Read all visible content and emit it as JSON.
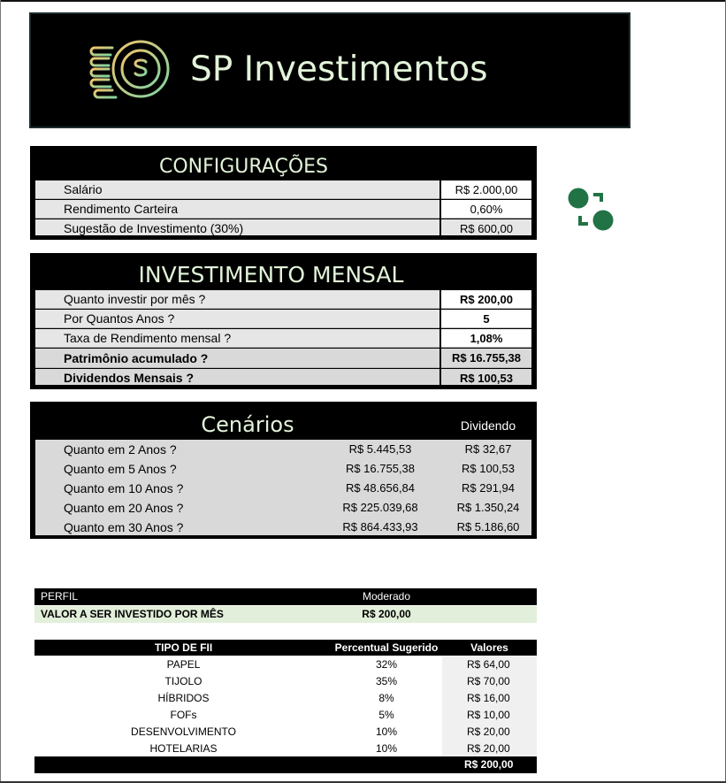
{
  "header": {
    "title": "SP Investimentos",
    "logo_icon": "coin-dollar-icon",
    "title_color": "#e2f3d9"
  },
  "configuracoes": {
    "title": "CONFIGURAÇÕES",
    "rows": [
      {
        "label": "Salário",
        "value": "R$ 2.000,00"
      },
      {
        "label": "Rendimento Carteira",
        "value": "0,60%"
      },
      {
        "label": "Sugestão de Investimento (30%)",
        "value": "R$ 600,00"
      }
    ]
  },
  "investimento": {
    "title": "INVESTIMENTO MENSAL",
    "rows": [
      {
        "label": "Quanto investir por mês ?",
        "value": "R$ 200,00"
      },
      {
        "label": "Por Quantos Anos ?",
        "value": "5"
      },
      {
        "label": "Taxa de Rendimento mensal ?",
        "value": "1,08%"
      },
      {
        "label": "Patrimônio acumulado ?",
        "value": "R$ 16.755,38"
      },
      {
        "label": "Dividendos Mensais ?",
        "value": "R$ 100,53"
      }
    ]
  },
  "cenarios": {
    "title": "Cenários",
    "dividend_header": "Dividendo",
    "rows": [
      {
        "label": "Quanto em 2 Anos ?",
        "total": "R$ 5.445,53",
        "dividend": "R$ 32,67"
      },
      {
        "label": "Quanto em 5 Anos ?",
        "total": "R$ 16.755,38",
        "dividend": "R$ 100,53"
      },
      {
        "label": "Quanto em 10 Anos ?",
        "total": "R$ 48.656,84",
        "dividend": "R$ 291,94"
      },
      {
        "label": "Quanto em 20 Anos ?",
        "total": "R$ 225.039,68",
        "dividend": "R$ 1.350,24"
      },
      {
        "label": "Quanto em 30 Anos ?",
        "total": "R$ 864.433,93",
        "dividend": "R$ 5.186,60"
      }
    ]
  },
  "switch_icon": {
    "name": "switch-arrows-icon",
    "color": "#217346"
  },
  "perfil": {
    "label": "PERFIL",
    "value": "Moderado",
    "invest_label": "VALOR A SER INVESTIDO POR MÊS",
    "invest_value": "R$ 200,00"
  },
  "fii": {
    "headers": [
      "TIPO DE FII",
      "Percentual Sugerido",
      "Valores"
    ],
    "rows": [
      {
        "tipo": "PAPEL",
        "percentual": "32%",
        "valor": "R$ 64,00"
      },
      {
        "tipo": "TIJOLO",
        "percentual": "35%",
        "valor": "R$ 70,00"
      },
      {
        "tipo": "HÍBRIDOS",
        "percentual": "8%",
        "valor": "R$ 16,00"
      },
      {
        "tipo": "FOFs",
        "percentual": "5%",
        "valor": "R$ 10,00"
      },
      {
        "tipo": "DESENVOLVIMENTO",
        "percentual": "10%",
        "valor": "R$ 20,00"
      },
      {
        "tipo": "HOTELARIAS",
        "percentual": "10%",
        "valor": "R$ 20,00"
      }
    ],
    "total": "R$ 200,00"
  }
}
